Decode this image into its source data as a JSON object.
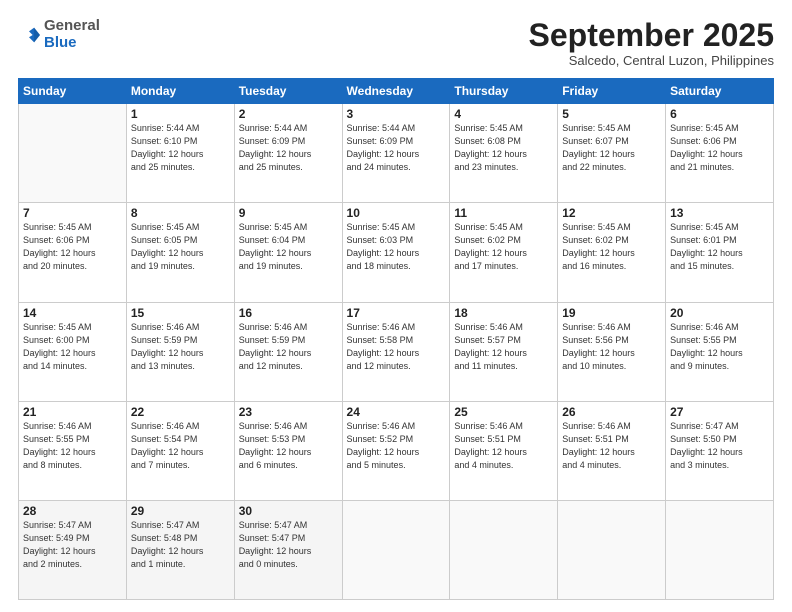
{
  "header": {
    "logo_general": "General",
    "logo_blue": "Blue",
    "month_title": "September 2025",
    "location": "Salcedo, Central Luzon, Philippines"
  },
  "weekdays": [
    "Sunday",
    "Monday",
    "Tuesday",
    "Wednesday",
    "Thursday",
    "Friday",
    "Saturday"
  ],
  "weeks": [
    [
      {
        "day": "",
        "info": ""
      },
      {
        "day": "1",
        "info": "Sunrise: 5:44 AM\nSunset: 6:10 PM\nDaylight: 12 hours\nand 25 minutes."
      },
      {
        "day": "2",
        "info": "Sunrise: 5:44 AM\nSunset: 6:09 PM\nDaylight: 12 hours\nand 25 minutes."
      },
      {
        "day": "3",
        "info": "Sunrise: 5:44 AM\nSunset: 6:09 PM\nDaylight: 12 hours\nand 24 minutes."
      },
      {
        "day": "4",
        "info": "Sunrise: 5:45 AM\nSunset: 6:08 PM\nDaylight: 12 hours\nand 23 minutes."
      },
      {
        "day": "5",
        "info": "Sunrise: 5:45 AM\nSunset: 6:07 PM\nDaylight: 12 hours\nand 22 minutes."
      },
      {
        "day": "6",
        "info": "Sunrise: 5:45 AM\nSunset: 6:06 PM\nDaylight: 12 hours\nand 21 minutes."
      }
    ],
    [
      {
        "day": "7",
        "info": "Sunrise: 5:45 AM\nSunset: 6:06 PM\nDaylight: 12 hours\nand 20 minutes."
      },
      {
        "day": "8",
        "info": "Sunrise: 5:45 AM\nSunset: 6:05 PM\nDaylight: 12 hours\nand 19 minutes."
      },
      {
        "day": "9",
        "info": "Sunrise: 5:45 AM\nSunset: 6:04 PM\nDaylight: 12 hours\nand 19 minutes."
      },
      {
        "day": "10",
        "info": "Sunrise: 5:45 AM\nSunset: 6:03 PM\nDaylight: 12 hours\nand 18 minutes."
      },
      {
        "day": "11",
        "info": "Sunrise: 5:45 AM\nSunset: 6:02 PM\nDaylight: 12 hours\nand 17 minutes."
      },
      {
        "day": "12",
        "info": "Sunrise: 5:45 AM\nSunset: 6:02 PM\nDaylight: 12 hours\nand 16 minutes."
      },
      {
        "day": "13",
        "info": "Sunrise: 5:45 AM\nSunset: 6:01 PM\nDaylight: 12 hours\nand 15 minutes."
      }
    ],
    [
      {
        "day": "14",
        "info": "Sunrise: 5:45 AM\nSunset: 6:00 PM\nDaylight: 12 hours\nand 14 minutes."
      },
      {
        "day": "15",
        "info": "Sunrise: 5:46 AM\nSunset: 5:59 PM\nDaylight: 12 hours\nand 13 minutes."
      },
      {
        "day": "16",
        "info": "Sunrise: 5:46 AM\nSunset: 5:59 PM\nDaylight: 12 hours\nand 12 minutes."
      },
      {
        "day": "17",
        "info": "Sunrise: 5:46 AM\nSunset: 5:58 PM\nDaylight: 12 hours\nand 12 minutes."
      },
      {
        "day": "18",
        "info": "Sunrise: 5:46 AM\nSunset: 5:57 PM\nDaylight: 12 hours\nand 11 minutes."
      },
      {
        "day": "19",
        "info": "Sunrise: 5:46 AM\nSunset: 5:56 PM\nDaylight: 12 hours\nand 10 minutes."
      },
      {
        "day": "20",
        "info": "Sunrise: 5:46 AM\nSunset: 5:55 PM\nDaylight: 12 hours\nand 9 minutes."
      }
    ],
    [
      {
        "day": "21",
        "info": "Sunrise: 5:46 AM\nSunset: 5:55 PM\nDaylight: 12 hours\nand 8 minutes."
      },
      {
        "day": "22",
        "info": "Sunrise: 5:46 AM\nSunset: 5:54 PM\nDaylight: 12 hours\nand 7 minutes."
      },
      {
        "day": "23",
        "info": "Sunrise: 5:46 AM\nSunset: 5:53 PM\nDaylight: 12 hours\nand 6 minutes."
      },
      {
        "day": "24",
        "info": "Sunrise: 5:46 AM\nSunset: 5:52 PM\nDaylight: 12 hours\nand 5 minutes."
      },
      {
        "day": "25",
        "info": "Sunrise: 5:46 AM\nSunset: 5:51 PM\nDaylight: 12 hours\nand 4 minutes."
      },
      {
        "day": "26",
        "info": "Sunrise: 5:46 AM\nSunset: 5:51 PM\nDaylight: 12 hours\nand 4 minutes."
      },
      {
        "day": "27",
        "info": "Sunrise: 5:47 AM\nSunset: 5:50 PM\nDaylight: 12 hours\nand 3 minutes."
      }
    ],
    [
      {
        "day": "28",
        "info": "Sunrise: 5:47 AM\nSunset: 5:49 PM\nDaylight: 12 hours\nand 2 minutes."
      },
      {
        "day": "29",
        "info": "Sunrise: 5:47 AM\nSunset: 5:48 PM\nDaylight: 12 hours\nand 1 minute."
      },
      {
        "day": "30",
        "info": "Sunrise: 5:47 AM\nSunset: 5:47 PM\nDaylight: 12 hours\nand 0 minutes."
      },
      {
        "day": "",
        "info": ""
      },
      {
        "day": "",
        "info": ""
      },
      {
        "day": "",
        "info": ""
      },
      {
        "day": "",
        "info": ""
      }
    ]
  ]
}
